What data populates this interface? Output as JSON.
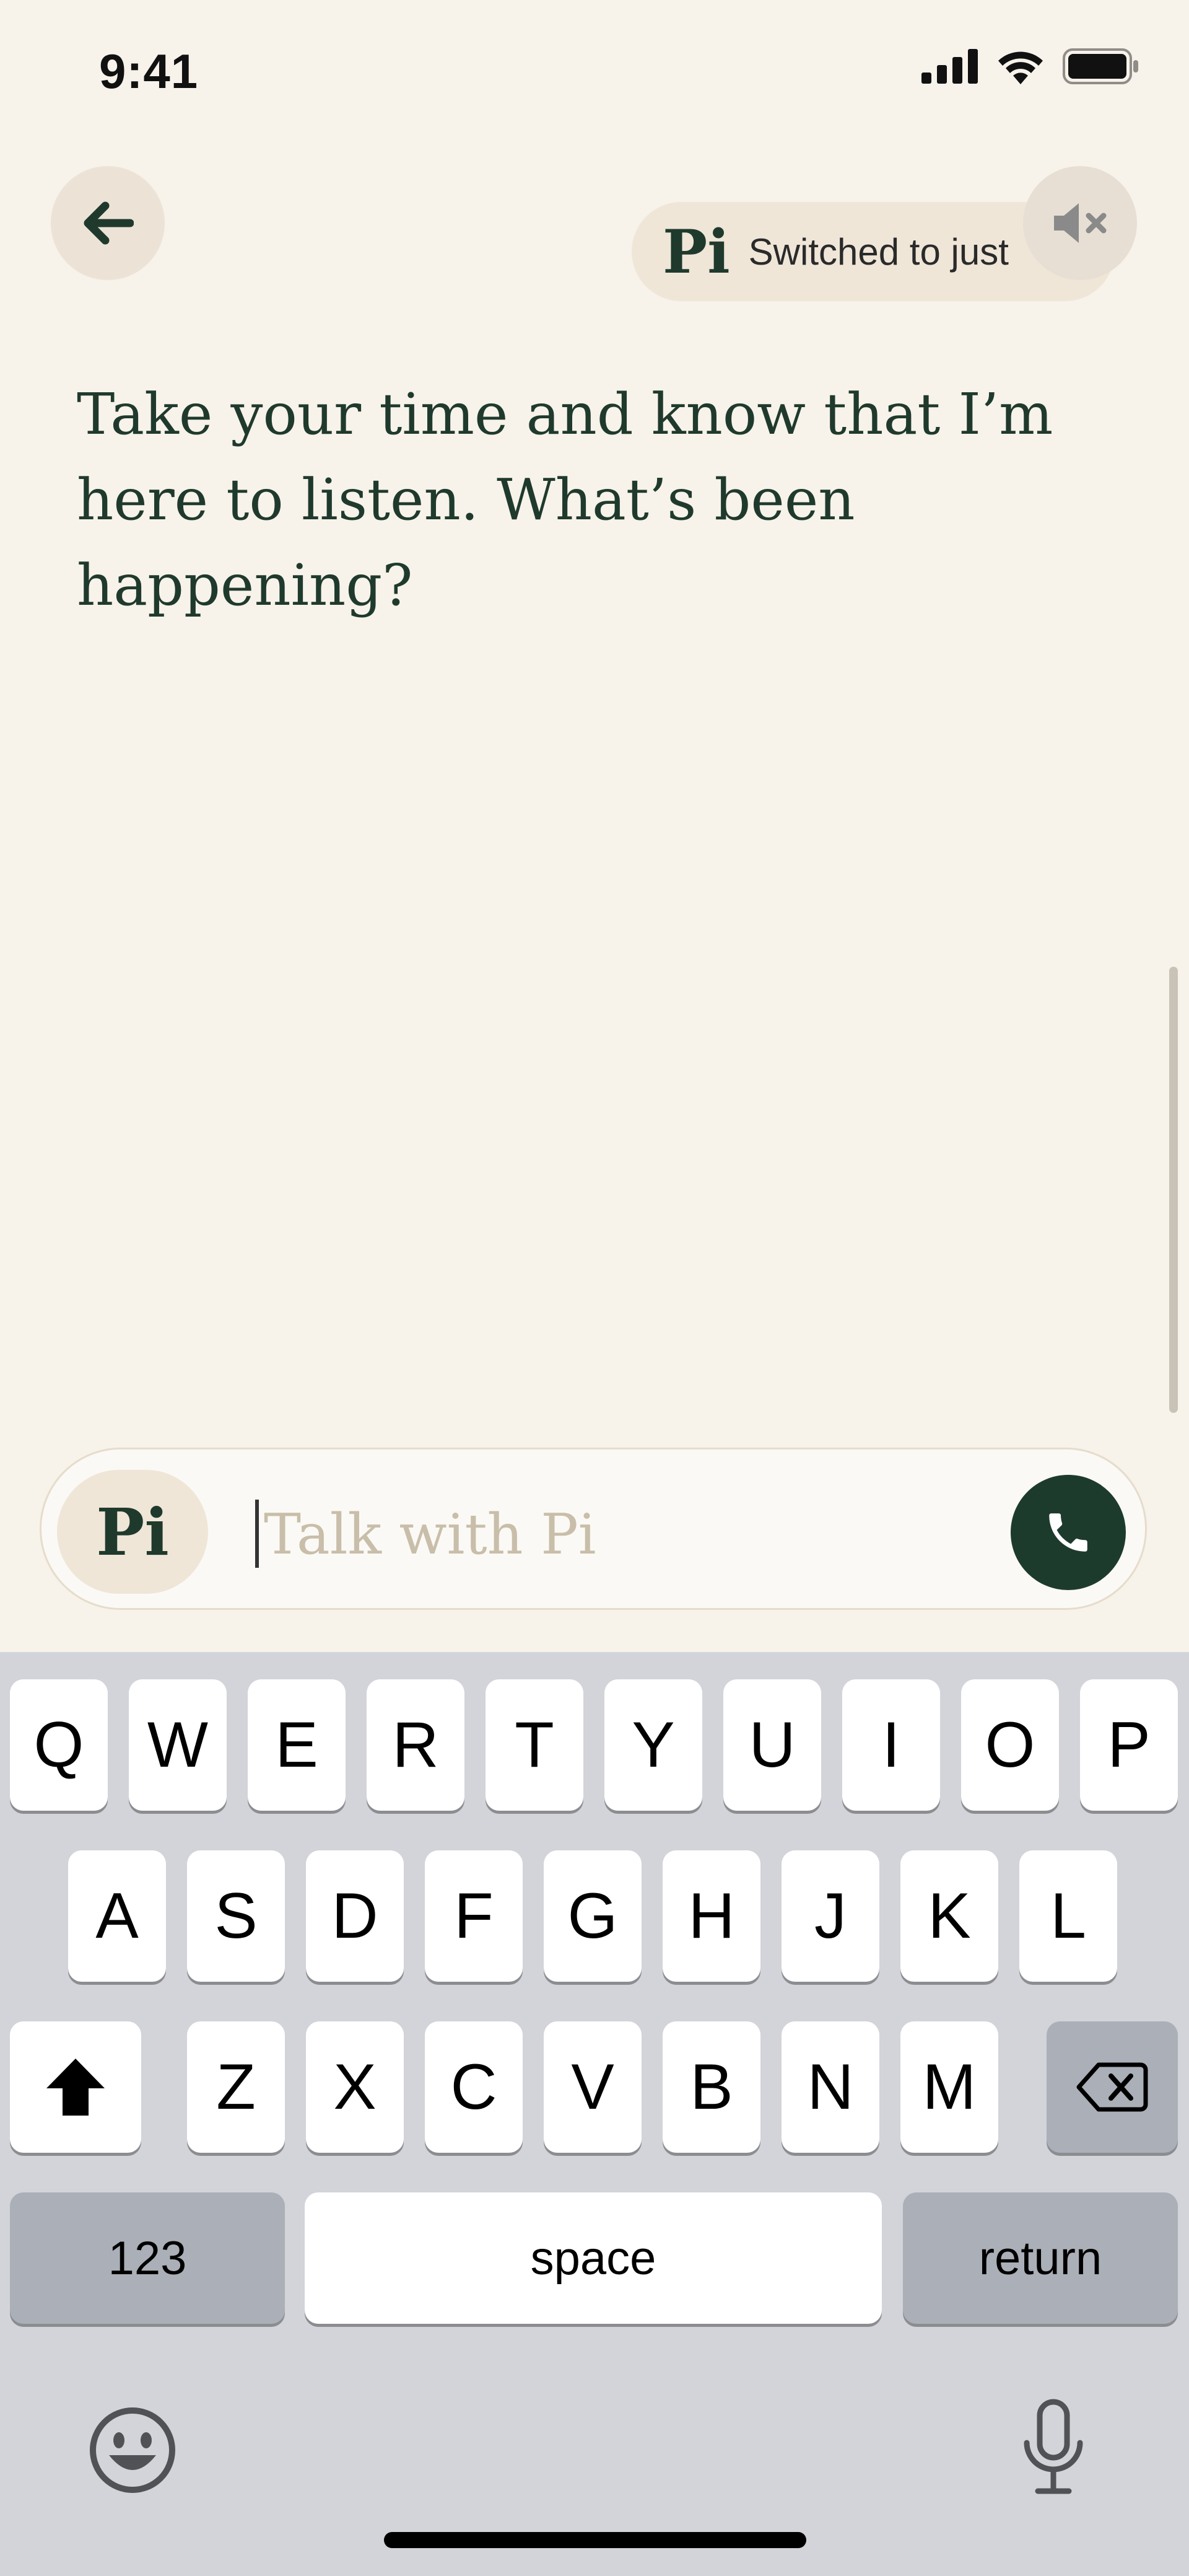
{
  "status_bar": {
    "time": "9:41"
  },
  "toast": {
    "logo": "Pi",
    "text": "Switched to just"
  },
  "message": {
    "text": "Take your time and know that I’m here to listen. What’s been happening?"
  },
  "input": {
    "logo": "Pi",
    "placeholder": "Talk with Pi"
  },
  "keyboard": {
    "row1": [
      "Q",
      "W",
      "E",
      "R",
      "T",
      "Y",
      "U",
      "I",
      "O",
      "P"
    ],
    "row2": [
      "A",
      "S",
      "D",
      "F",
      "G",
      "H",
      "J",
      "K",
      "L"
    ],
    "row3": [
      "Z",
      "X",
      "C",
      "V",
      "B",
      "N",
      "M"
    ],
    "numbers_label": "123",
    "space_label": "space",
    "return_label": "return"
  },
  "icons": {
    "back": "arrow-left-icon",
    "mute": "speaker-muted-icon",
    "call": "phone-icon",
    "shift": "shift-icon",
    "delete": "backspace-icon",
    "emoji": "emoji-icon",
    "dictation": "microphone-icon"
  },
  "colors": {
    "background": "#f7f2ea",
    "accent": "#1d3b2c",
    "keyboard_bg": "#d2d4d9"
  }
}
